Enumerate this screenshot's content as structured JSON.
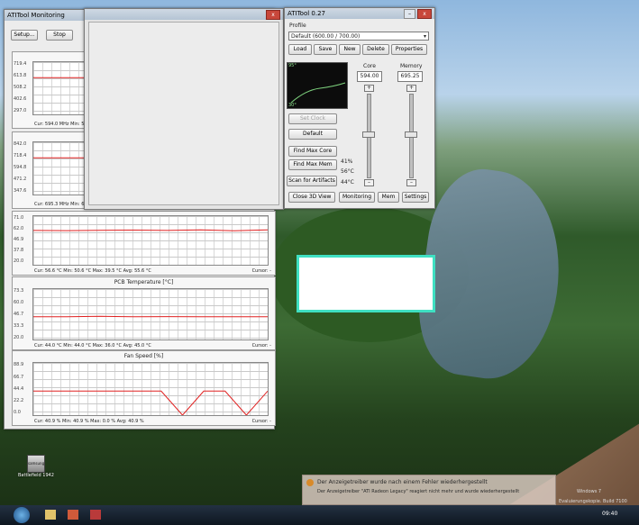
{
  "monitoring": {
    "title": "ATITool Monitoring",
    "setup_label": "Setup...",
    "stop_label": "Stop",
    "graphs": [
      {
        "title": "",
        "ticks": [
          "719.4",
          "613.8",
          "508.2",
          "402.6",
          "297.0"
        ],
        "stats": "Cur: 594.0 MHz   Min: 59",
        "cursor": ""
      },
      {
        "title": "",
        "ticks": [
          "842.0",
          "718.4",
          "594.8",
          "471.2",
          "347.6"
        ],
        "stats": "Cur: 695.3 MHz   Min: 69",
        "cursor": ""
      },
      {
        "title": "",
        "ticks": [
          "71.0",
          "62.0",
          "46.9",
          "37.8",
          "20.0"
        ],
        "stats": "Cur: 56.6 °C   Min: 50.6 °C   Max: 39.5 °C   Avg: 55.6 °C",
        "cursor": "Cursor: -"
      },
      {
        "title": "PCB Temperature [°C]",
        "ticks": [
          "73.3",
          "60.0",
          "46.7",
          "33.3",
          "20.0"
        ],
        "stats": "Cur: 44.0 °C   Min: 44.0 °C   Max: 36.0 °C   Avg: 45.0 °C",
        "cursor": "Cursor: -"
      },
      {
        "title": "Fan Speed [%]",
        "ticks": [
          "88.9",
          "66.7",
          "44.4",
          "22.2",
          "0.0"
        ],
        "stats": "Cur: 40.9 %   Min: 40.9 %   Max: 0.0 %   Avg: 40.9 %",
        "cursor": "Cursor: -"
      }
    ]
  },
  "blank_window": {
    "close_label": "x"
  },
  "atitool": {
    "title": "ATITool 0.27",
    "profile_label": "Profile",
    "profile_value": "Default (600.00 / 700.00)",
    "load_label": "Load",
    "save_label": "Save",
    "new_label": "New",
    "delete_label": "Delete",
    "properties_label": "Properties",
    "core_label": "Core",
    "memory_label": "Memory",
    "core_value": "594.00",
    "memory_value": "695.25",
    "set_clock_label": "Set Clock",
    "default_label": "Default",
    "find_max_core_label": "Find Max Core",
    "find_max_mem_label": "Find Max Mem",
    "scan_label": "Scan for Artifacts",
    "close_3d_label": "Close 3D View",
    "monitoring_label": "Monitoring",
    "mem_label": "Mem",
    "settings_label": "Settings",
    "readout_1": "41%",
    "readout_2": "56°C",
    "readout_3": "44°C",
    "mini_graph_top": "95°",
    "mini_graph_bottom": "30°"
  },
  "desktop": {
    "icon_label": "Battlefield 1942",
    "icon_caption": "samsung",
    "notification_title": "Der Anzeigetreiber wurde nach einem Fehler wiederhergestellt",
    "notification_body": "Der Anzeigetreiber \"ATI Radeon Legacy\" reagiert nicht mehr und wurde wiederhergestellt",
    "watermark": "Evaluierungskopie. Build 7100",
    "watermark2": "Windows 7",
    "clock": "09:40"
  },
  "colors": {
    "graph_line": "#e02020",
    "teal_border": "#3fe0c2"
  },
  "chart_data": [
    {
      "type": "line",
      "title": "",
      "ylim": [
        297.0,
        719.4
      ],
      "series": [
        {
          "values": [
            594.0,
            594.0,
            594.0,
            594.0,
            594.0,
            594.0
          ]
        }
      ]
    },
    {
      "type": "line",
      "title": "",
      "ylim": [
        347.6,
        842.0
      ],
      "series": [
        {
          "values": [
            695.3,
            695.3,
            695.3,
            695.3,
            695.3,
            695.3
          ]
        }
      ]
    },
    {
      "type": "line",
      "title": "",
      "ylim": [
        20.0,
        71.0
      ],
      "series": [
        {
          "values": [
            56.0,
            55.8,
            56.2,
            56.4,
            56.0,
            56.6,
            55.6,
            56.6
          ]
        }
      ]
    },
    {
      "type": "line",
      "title": "PCB Temperature [°C]",
      "ylim": [
        20.0,
        73.3
      ],
      "series": [
        {
          "values": [
            44.0,
            44.0,
            44.5,
            44.0,
            44.2,
            44.0,
            44.0,
            44.0
          ]
        }
      ]
    },
    {
      "type": "line",
      "title": "Fan Speed [%]",
      "ylim": [
        0.0,
        88.9
      ],
      "series": [
        {
          "values": [
            40.9,
            40.9,
            40.9,
            40.9,
            40.9,
            40.9,
            40.9,
            0.0,
            40.9,
            40.9,
            0.0,
            40.9
          ]
        }
      ]
    }
  ]
}
